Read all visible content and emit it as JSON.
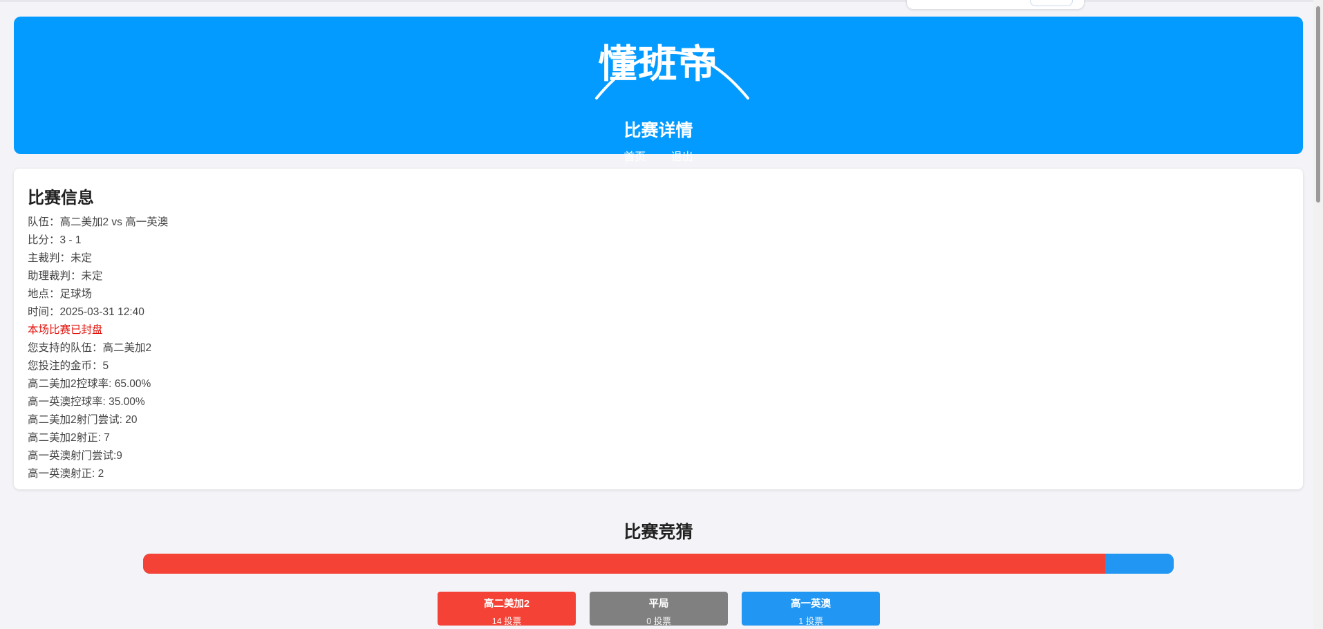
{
  "header": {
    "logo_text": "懂班帝",
    "page_title": "比赛详情",
    "nav": [
      "首页",
      "退出"
    ]
  },
  "info": {
    "title": "比赛信息",
    "lines": [
      "队伍：高二美加2 vs 高一英澳",
      "比分：3 - 1",
      "主裁判：未定",
      "助理裁判：未定",
      "地点：足球场",
      "时间：2025-03-31 12:40"
    ],
    "closed_notice": "本场比赛已封盘",
    "bet_lines": [
      "您支持的队伍：高二美加2",
      "您投注的金币：5"
    ],
    "stats": [
      "高二美加2控球率: 65.00%",
      "高一英澳控球率: 35.00%",
      "高二美加2射门尝试: 20",
      "高二美加2射正: 7",
      "高一英澳射门尝试:9",
      "高一英澳射正: 2"
    ]
  },
  "guess": {
    "title": "比赛竞猜",
    "options": [
      {
        "team": "高二美加2",
        "votes": 14,
        "count_label": "14 投票",
        "color": "#f44336"
      },
      {
        "team": "平局",
        "votes": 0,
        "count_label": "0 投票",
        "color": "#808080"
      },
      {
        "team": "高一英澳",
        "votes": 1,
        "count_label": "1 投票",
        "color": "#2196f3"
      }
    ]
  },
  "colors": {
    "header_bg": "#039bff",
    "page_bg": "#f4f4f8",
    "closed_text": "#e3120b"
  }
}
